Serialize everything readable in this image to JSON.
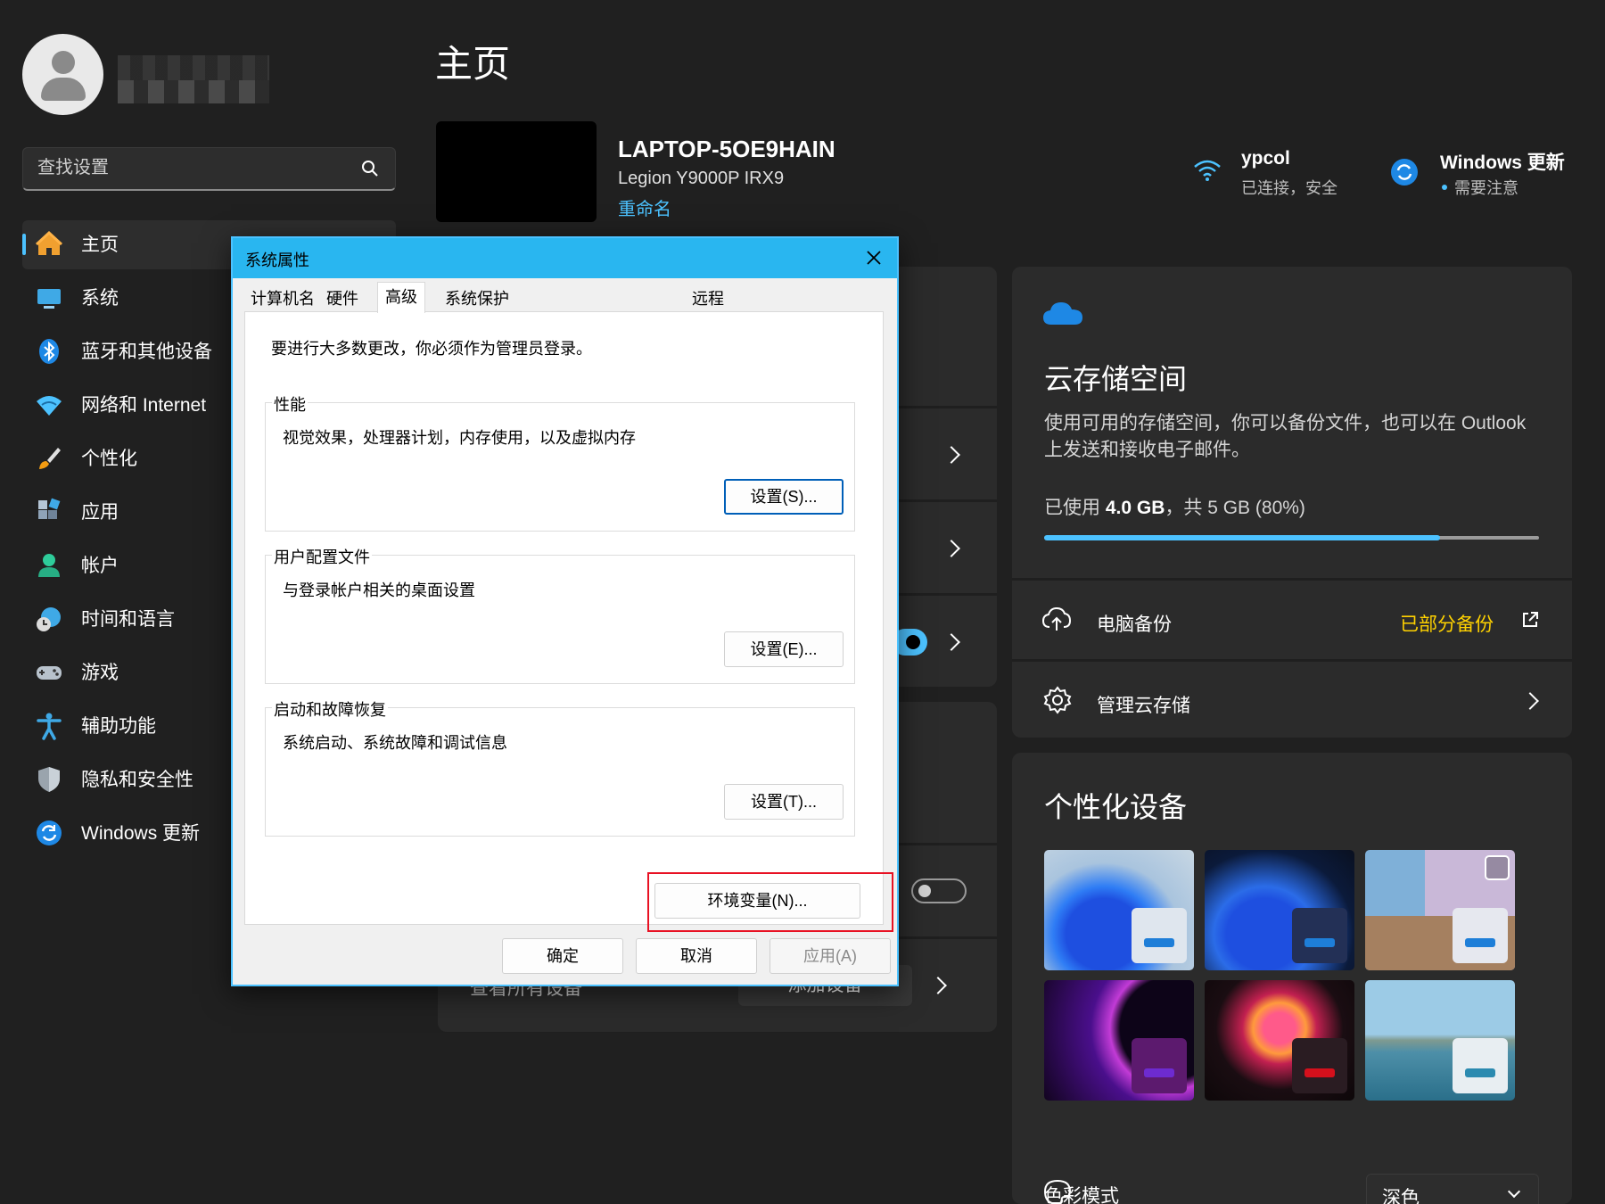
{
  "user": {
    "avatar_icon": "person-icon"
  },
  "search": {
    "placeholder": "查找设置"
  },
  "sidebar": {
    "items": [
      {
        "label": "主页",
        "icon": "home-icon"
      },
      {
        "label": "系统",
        "icon": "monitor-icon"
      },
      {
        "label": "蓝牙和其他设备",
        "icon": "bluetooth-icon"
      },
      {
        "label": "网络和 Internet",
        "icon": "wifi-icon"
      },
      {
        "label": "个性化",
        "icon": "brush-icon"
      },
      {
        "label": "应用",
        "icon": "apps-icon"
      },
      {
        "label": "帐户",
        "icon": "account-icon"
      },
      {
        "label": "时间和语言",
        "icon": "clock-globe-icon"
      },
      {
        "label": "游戏",
        "icon": "gamepad-icon"
      },
      {
        "label": "辅助功能",
        "icon": "accessibility-icon"
      },
      {
        "label": "隐私和安全性",
        "icon": "shield-icon"
      },
      {
        "label": "Windows 更新",
        "icon": "update-icon"
      }
    ]
  },
  "main": {
    "title": "主页",
    "device": {
      "name": "LAPTOP-5OE9HAIN",
      "model": "Legion Y9000P IRX9",
      "rename": "重命名"
    },
    "network": {
      "name": "ypcol",
      "status": "已连接，安全"
    },
    "update": {
      "title": "Windows 更新",
      "status": "需要注意"
    },
    "partial_text": "查看所有设备",
    "partial_button": "添加设备"
  },
  "cloud": {
    "title": "云存储空间",
    "description": "使用可用的存储空间，你可以备份文件，也可以在 Outlook 上发送和接收电子邮件。",
    "usage_prefix": "已使用 ",
    "usage_value": "4.0 GB",
    "usage_suffix": "，共 5 GB (80%)",
    "usage_fraction": 0.8,
    "backup_label": "电脑备份",
    "backup_status": "已部分备份",
    "manage_label": "管理云存储"
  },
  "personalize": {
    "title": "个性化设备",
    "color_mode_label": "色彩模式",
    "color_mode_value": "深色"
  },
  "dialog": {
    "title": "系统属性",
    "tabs": [
      "计算机名",
      "硬件",
      "高级",
      "系统保护",
      "远程"
    ],
    "active_tab": "高级",
    "admin_note": "要进行大多数更改，你必须作为管理员登录。",
    "performance": {
      "title": "性能",
      "desc": "视觉效果，处理器计划，内存使用，以及虚拟内存",
      "button": "设置(S)..."
    },
    "profiles": {
      "title": "用户配置文件",
      "desc": "与登录帐户相关的桌面设置",
      "button": "设置(E)..."
    },
    "startup": {
      "title": "启动和故障恢复",
      "desc": "系统启动、系统故障和调试信息",
      "button": "设置(T)..."
    },
    "env_button": "环境变量(N)...",
    "ok": "确定",
    "cancel": "取消",
    "apply": "应用(A)"
  },
  "colors": {
    "accent": "#4cc2ff",
    "warning": "#ffd200",
    "highlight": "#e81123",
    "titlebar": "#29b6f0"
  }
}
